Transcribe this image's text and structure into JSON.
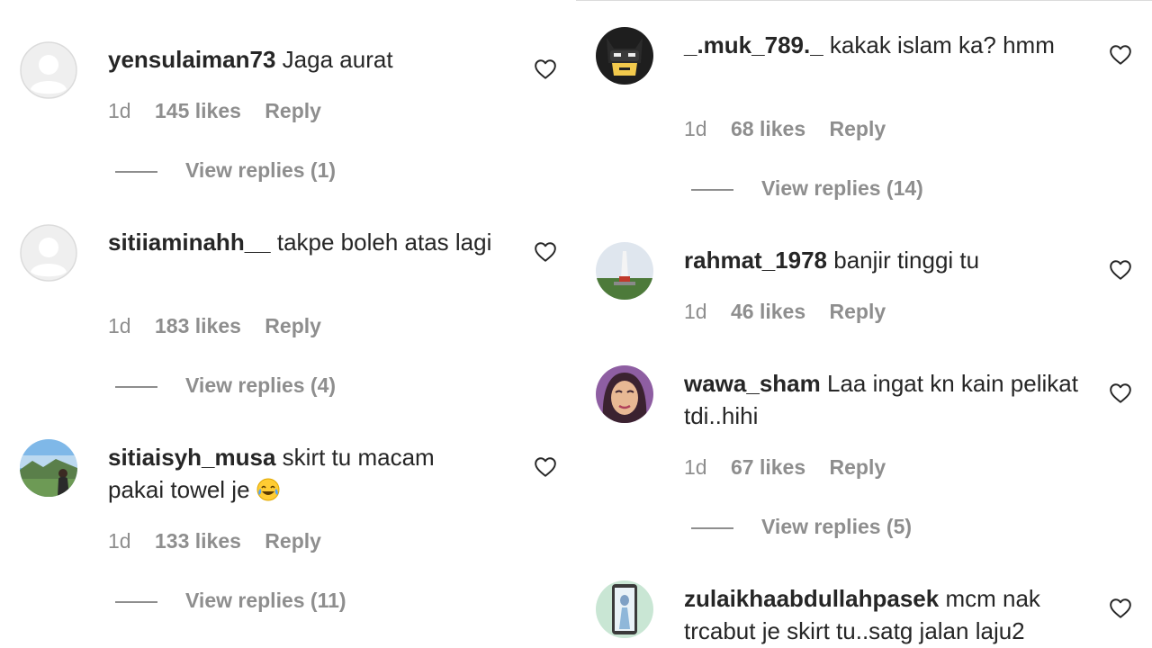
{
  "left_comments": [
    {
      "username": "yensulaiman73",
      "text": "Jaga aurat",
      "time": "1d",
      "likes": "145 likes",
      "reply": "Reply",
      "view_replies": "View replies (1)"
    },
    {
      "username": "sitiiaminahh__",
      "text": "takpe boleh atas lagi",
      "time": "1d",
      "likes": "183 likes",
      "reply": "Reply",
      "view_replies": "View replies (4)"
    },
    {
      "username": "sitiaisyh_musa",
      "text": "skirt tu macam pakai towel je",
      "time": "1d",
      "likes": "133 likes",
      "reply": "Reply",
      "view_replies": "View replies (11)"
    }
  ],
  "right_comments": [
    {
      "username": "_.muk_789._",
      "text": "kakak islam ka? hmm",
      "time": "1d",
      "likes": "68 likes",
      "reply": "Reply",
      "view_replies": "View replies (14)"
    },
    {
      "username": "rahmat_1978",
      "text": "banjir tinggi tu",
      "time": "1d",
      "likes": "46 likes",
      "reply": "Reply"
    },
    {
      "username": "wawa_sham",
      "text": "Laa ingat kn kain pelikat tdi..hihi",
      "time": "1d",
      "likes": "67 likes",
      "reply": "Reply",
      "view_replies": "View replies (5)"
    },
    {
      "username": "zulaikhaabdullahpasek",
      "text": "mcm nak trcabut je skirt tu..satg jalan laju2"
    }
  ],
  "icons": {
    "like": "heart-outline-icon",
    "emoji": "face-with-tears-of-joy-emoji",
    "default_avatar": "default-avatar-icon"
  },
  "colors": {
    "text": "#262626",
    "secondary": "#8e8e8e",
    "divider": "#dbdbdb"
  }
}
